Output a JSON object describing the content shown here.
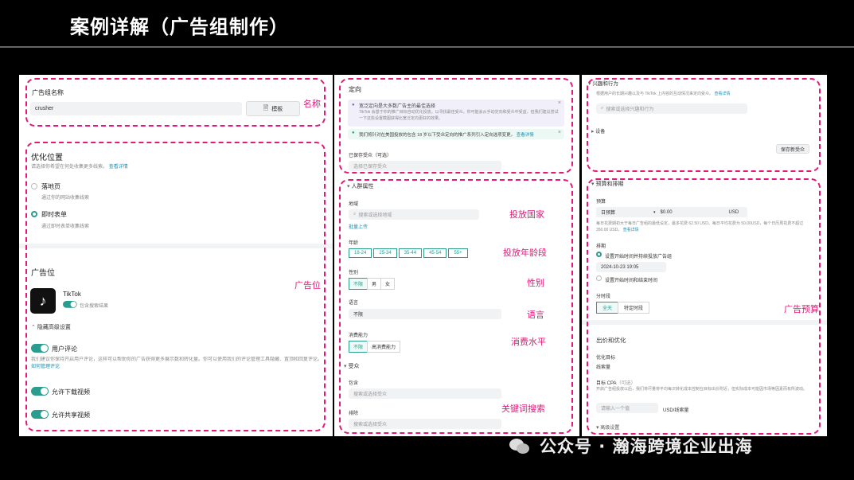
{
  "slide": {
    "title": "案例详解（广告组制作）",
    "watermark": "公众号 · 瀚海跨境企业出海"
  },
  "colors": {
    "annotation": "#e4187a",
    "accent": "#2a9d8f",
    "link": "#1f8fb0"
  },
  "panel1": {
    "adgroup_name_label": "广告组名称",
    "adgroup_name_value": "crusher",
    "template_button": "模板",
    "note_name": "名称",
    "optimization_title": "优化位置",
    "optimization_sub": "请选择你希望在何处收集更多线索。",
    "optimization_link": "查看详情",
    "opt_landing_label": "落地页",
    "opt_landing_desc": "通过你的网站收集线索",
    "opt_instant_label": "即时表单",
    "opt_instant_desc": "通过即时表单收集线索",
    "placement_title": "广告位",
    "tiktok_label": "TikTok",
    "tiktok_toggle_label": "包含搜索结果",
    "note_placement": "广告位",
    "hide_advanced": "隐藏高级设置",
    "user_comment_label": "用户评论",
    "user_comment_desc": "我们建议你保持开启用户评论，这样可以帮助你的广告获得更多展示数和转化量。你可以使用我们的评论管理工具隐藏、置顶和回复评论。",
    "user_comment_link": "如何管理评论",
    "allow_download": "允许下载视频",
    "allow_share": "允许共享视频"
  },
  "panel2": {
    "targeting_title": "定向",
    "info1": "宽泛定向是大多数广告主的最佳选择",
    "info1_desc": "TikTok 会基于你的推广目标自动优化投放，以寻找最佳受众。你可能会从手动定向和受众中受益，但我们建议尝试一下这些设置截图获得比宽泛定向更好的效果。",
    "info2": "我们将针对在美国投放的包含 18 岁以下受众定向的推广系列引入定向选项变更。",
    "info2_link": "查看详情",
    "saved_audience_label": "已保存受众（可选）",
    "saved_audience_placeholder": "选择已保存受众",
    "demographics_title": "人群属性",
    "location_label": "地域",
    "location_placeholder": "搜索或选择地域",
    "bulk_upload": "批量上传",
    "note_country": "投放国家",
    "age_label": "年龄",
    "ages": [
      "18-24",
      "25-34",
      "35-44",
      "45-54",
      "55+"
    ],
    "note_age": "投放年龄段",
    "gender_label": "性别",
    "genders": [
      "不限",
      "男",
      "女"
    ],
    "note_gender": "性别",
    "language_label": "语言",
    "language_value": "不限",
    "note_language": "语言",
    "spending_label": "消费能力",
    "spending_options": [
      "不限",
      "高消费能力"
    ],
    "note_spending": "消费水平",
    "audience_title": "受众",
    "include_label": "包含",
    "include_placeholder": "搜索或选择受众",
    "exclude_label": "排除",
    "exclude_placeholder": "搜索或选择受众",
    "note_keyword": "关键词搜索"
  },
  "panel3": {
    "interest_title": "兴趣和行为",
    "interest_desc": "根据用户的长期兴趣以及与 TikTok 上内容的互动情况来定向受众。",
    "interest_link": "查看详情",
    "interest_placeholder": "搜索或选择兴趣和行为",
    "device_label": "设备",
    "save_audience_button": "保存新受众",
    "budget_title": "预算和排期",
    "budget_label": "预算",
    "budget_type": "日预算",
    "budget_value": "$0.00",
    "budget_currency": "USD",
    "budget_note": "每日花费期初大于每日广告组的最低设定，最多花费 62.50 USD。每日平均花费为 50.00USD，每个日历周花费不超过 350.00 USD。",
    "budget_note_link": "查看详情",
    "schedule_label": "排期",
    "schedule_opt1": "设置开始时间并持续投放广告组",
    "schedule_datetime": "2024-10-23 19:05",
    "schedule_opt2": "设置开始时间和结束时间",
    "dayparting_label": "分时段",
    "dayparting_options": [
      "全天",
      "特定时段"
    ],
    "note_budget": "广告预算",
    "bid_title": "出价和优化",
    "opt_goal_label": "优化目标",
    "opt_goal_value": "线索量",
    "target_cpa_label": "目标 CPA",
    "target_cpa_optional": "（可选）",
    "target_cpa_desc": "开启广告组投放以后，我们将尽量将平均每次转化成本控制在目标出价附近，但实际成本可能因市场等因素而有所波动。",
    "cpa_placeholder": "请输入一个值",
    "cpa_unit": "USD/线索量",
    "advanced_settings": "高级设置"
  }
}
